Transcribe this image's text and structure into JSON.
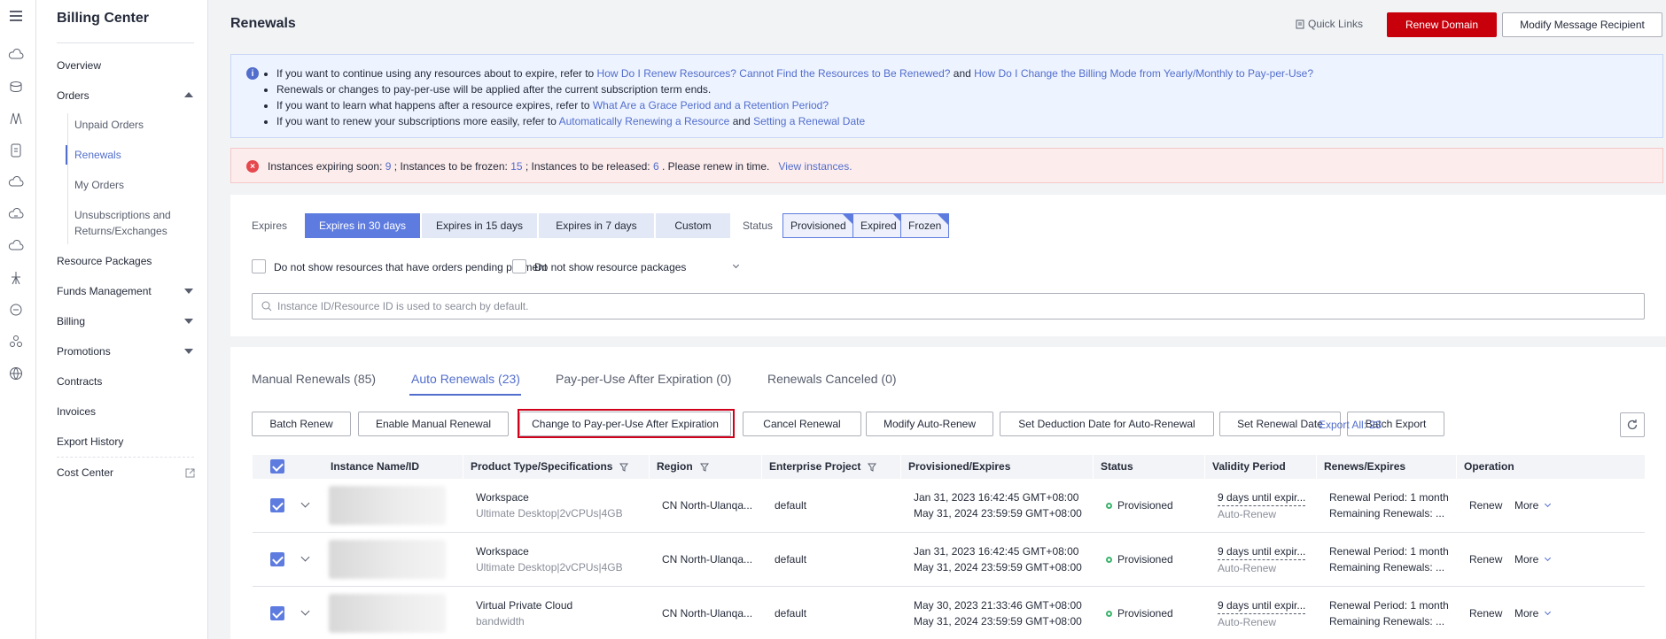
{
  "sidebar": {
    "title": "Billing Center",
    "items": [
      {
        "label": "Overview"
      },
      {
        "label": "Orders"
      },
      {
        "label": "Unpaid Orders"
      },
      {
        "label": "Renewals"
      },
      {
        "label": "My Orders"
      },
      {
        "label": "Unsubscriptions and Returns/Exchanges"
      },
      {
        "label": "Resource Packages"
      },
      {
        "label": "Funds Management"
      },
      {
        "label": "Billing"
      },
      {
        "label": "Promotions"
      },
      {
        "label": "Contracts"
      },
      {
        "label": "Invoices"
      },
      {
        "label": "Export History"
      },
      {
        "label": "Cost Center"
      }
    ]
  },
  "header": {
    "title": "Renewals",
    "quick_links": "Quick Links",
    "renew_domain": "Renew Domain",
    "modify_recipient": "Modify Message Recipient"
  },
  "info": {
    "l1_pre": "If you want to continue using any resources about to expire, refer to ",
    "l1_link1": "How Do I Renew Resources? Cannot Find the Resources to Be Renewed?",
    "l1_mid": " and ",
    "l1_link2": "How Do I Change the Billing Mode from Yearly/Monthly to Pay-per-Use?",
    "l2": "Renewals or changes to pay-per-use will be applied after the current subscription term ends.",
    "l3_pre": "If you want to learn what happens after a resource expires, refer to ",
    "l3_link": "What Are a Grace Period and a Retention Period?",
    "l4_pre": "If you want to renew your subscriptions more easily, refer to ",
    "l4_link1": "Automatically Renewing a Resource",
    "l4_mid": " and ",
    "l4_link2": "Setting a Renewal Date"
  },
  "warning": {
    "p1": "Instances expiring soon: ",
    "n1": "9",
    "p2": " ; Instances to be frozen: ",
    "n2": "15",
    "p3": " ; Instances to be released: ",
    "n3": "6",
    "p4": " . Please renew in time.",
    "link": "View instances."
  },
  "filters": {
    "expires_label": "Expires",
    "expires_options": [
      "Expires in 30 days",
      "Expires in 15 days",
      "Expires in 7 days",
      "Custom"
    ],
    "status_label": "Status",
    "status_tags": [
      "Provisioned",
      "Expired",
      "Frozen"
    ],
    "check1": "Do not show resources that have orders pending payment",
    "check2": "Do not show resource packages",
    "search_placeholder": "Instance ID/Resource ID is used to search by default."
  },
  "tabs": [
    "Manual Renewals (85)",
    "Auto Renewals (23)",
    "Pay-per-Use After Expiration (0)",
    "Renewals Canceled (0)"
  ],
  "actions": [
    "Batch Renew",
    "Enable Manual Renewal",
    "Change to Pay-per-Use After Expiration",
    "Cancel Renewal",
    "Modify Auto-Renew",
    "Set Deduction Date for Auto-Renewal",
    "Set Renewal Date",
    "Batch Export"
  ],
  "export_all": "Export All: 23",
  "table": {
    "headers": [
      "Instance Name/ID",
      "Product Type/Specifications",
      "Region",
      "Enterprise Project",
      "Provisioned/Expires",
      "Status",
      "Validity Period",
      "Renews/Expires",
      "Operation"
    ],
    "rows": [
      {
        "product": "Workspace",
        "spec": "Ultimate Desktop|2vCPUs|4GB",
        "region": "CN North-Ulanqa...",
        "project": "default",
        "prov": "Jan 31, 2023 16:42:45 GMT+08:00",
        "exp": "May 31, 2024 23:59:59 GMT+08:00",
        "status": "Provisioned",
        "validity": "9 days until expir...",
        "mode": "Auto-Renew",
        "period": "Renewal Period: 1 month",
        "remaining": "Remaining Renewals: ...",
        "op1": "Renew",
        "op2": "More"
      },
      {
        "product": "Workspace",
        "spec": "Ultimate Desktop|2vCPUs|4GB",
        "region": "CN North-Ulanqa...",
        "project": "default",
        "prov": "Jan 31, 2023 16:42:45 GMT+08:00",
        "exp": "May 31, 2024 23:59:59 GMT+08:00",
        "status": "Provisioned",
        "validity": "9 days until expir...",
        "mode": "Auto-Renew",
        "period": "Renewal Period: 1 month",
        "remaining": "Remaining Renewals: ...",
        "op1": "Renew",
        "op2": "More"
      },
      {
        "product": "Virtual Private Cloud",
        "spec": "bandwidth",
        "region": "CN North-Ulanqa...",
        "project": "default",
        "prov": "May 30, 2023 21:33:46 GMT+08:00",
        "exp": "May 31, 2024 23:59:59 GMT+08:00",
        "status": "Provisioned",
        "validity": "9 days until expir...",
        "mode": "Auto-Renew",
        "period": "Renewal Period: 1 month",
        "remaining": "Remaining Renewals: ...",
        "op1": "Renew",
        "op2": "More"
      }
    ]
  }
}
